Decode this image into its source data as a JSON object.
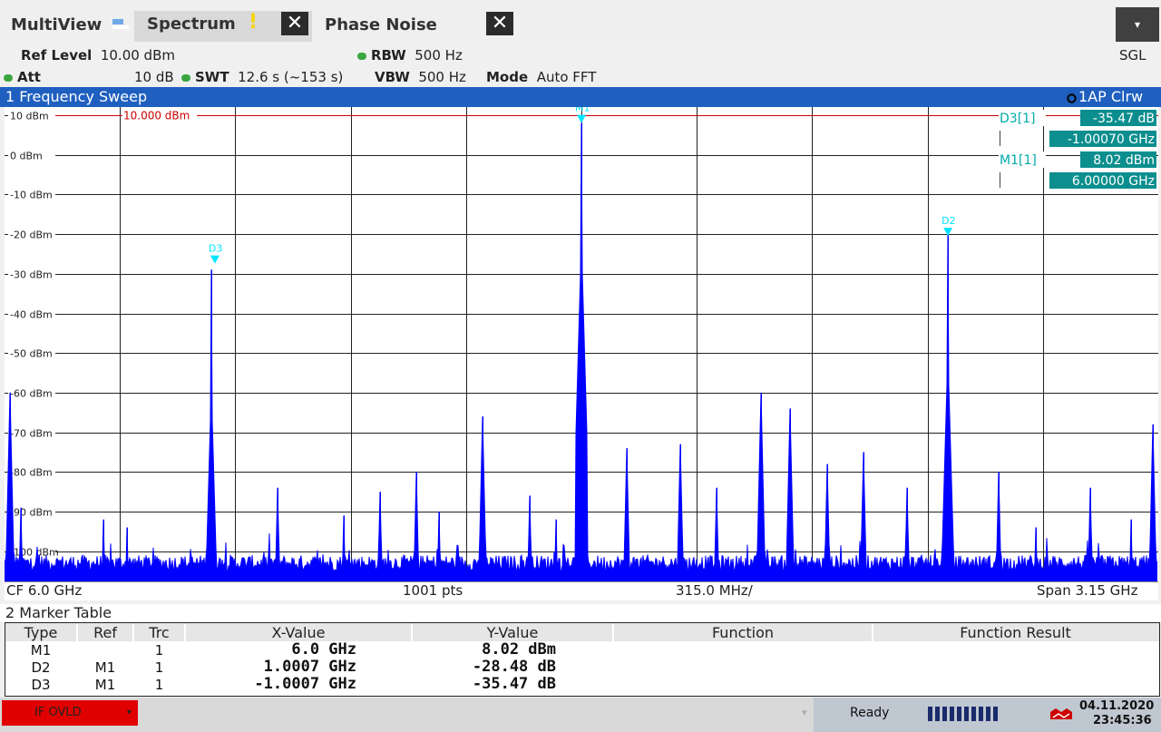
{
  "tabs": {
    "multiview": "MultiView",
    "spectrum": "Spectrum",
    "phase_noise": "Phase Noise",
    "close": "✕",
    "warning": "!",
    "menu": "▾"
  },
  "settings": {
    "ref_level_label": "Ref Level",
    "ref_level_value": "10.00 dBm",
    "att_label": "Att",
    "att_value": "10 dB",
    "swt_label": "SWT",
    "swt_value": "12.6 s (~153 s)",
    "rbw_label": "RBW",
    "rbw_value": "500 Hz",
    "vbw_label": "VBW",
    "vbw_value": "500 Hz",
    "mode_label": "Mode",
    "mode_value": "Auto FFT",
    "sgl": "SGL"
  },
  "diagram": {
    "title": "1 Frequency Sweep",
    "trace_info": "1AP Clrw",
    "ref_line_label": "10.000 dBm",
    "y_ticks": [
      "10 dBm",
      "0 dBm",
      "-10 dBm",
      "-20 dBm",
      "-30 dBm",
      "-40 dBm",
      "-50 dBm",
      "-60 dBm",
      "-70 dBm",
      "-80 dBm",
      "-90 dBm",
      "-100 dBm"
    ],
    "footer": {
      "cf": "CF 6.0 GHz",
      "pts": "1001 pts",
      "div": "315.0 MHz/",
      "span": "Span 3.15 GHz"
    },
    "marker_info": [
      {
        "name": "D3[1]",
        "value": "-35.47 dB",
        "x": "-1.00070 GHz"
      },
      {
        "name": "M1[1]",
        "value": "8.02 dBm",
        "x": "6.00000 GHz"
      }
    ],
    "marker_labels": [
      "M1",
      "D2",
      "D3"
    ]
  },
  "chart_data": {
    "type": "line",
    "xlim": [
      4.425,
      7.575
    ],
    "ylim": [
      -110,
      10
    ],
    "x_unit": "GHz",
    "y_unit": "dBm",
    "noise_floor": -103,
    "reference_level": 10.0,
    "peaks": [
      {
        "x": 4.44,
        "y": -60
      },
      {
        "x": 4.47,
        "y": -89
      },
      {
        "x": 4.52,
        "y": -101
      },
      {
        "x": 4.695,
        "y": -92
      },
      {
        "x": 4.76,
        "y": -94
      },
      {
        "x": 4.99,
        "y": -29
      },
      {
        "x": 5.17,
        "y": -84
      },
      {
        "x": 5.35,
        "y": -91
      },
      {
        "x": 5.45,
        "y": -85
      },
      {
        "x": 5.55,
        "y": -80
      },
      {
        "x": 5.61,
        "y": -90
      },
      {
        "x": 5.73,
        "y": -66
      },
      {
        "x": 5.86,
        "y": -86
      },
      {
        "x": 5.93,
        "y": -92
      },
      {
        "x": 6.0,
        "y": 8.02
      },
      {
        "x": 6.125,
        "y": -74
      },
      {
        "x": 6.27,
        "y": -73
      },
      {
        "x": 6.37,
        "y": -84
      },
      {
        "x": 6.49,
        "y": -60
      },
      {
        "x": 6.57,
        "y": -64
      },
      {
        "x": 6.67,
        "y": -78
      },
      {
        "x": 6.77,
        "y": -75
      },
      {
        "x": 6.89,
        "y": -84
      },
      {
        "x": 7.0,
        "y": -20
      },
      {
        "x": 7.14,
        "y": -80
      },
      {
        "x": 7.24,
        "y": -94
      },
      {
        "x": 7.39,
        "y": -84
      },
      {
        "x": 7.5,
        "y": -92
      },
      {
        "x": 7.56,
        "y": -68
      }
    ],
    "markers": [
      {
        "name": "M1",
        "x": 6.0,
        "y": 8.02
      },
      {
        "name": "D2",
        "x": 7.0007,
        "y": -20.46
      },
      {
        "name": "D3",
        "x": 4.9993,
        "y": -27.45
      }
    ]
  },
  "marker_table": {
    "title": "2 Marker Table",
    "headers": [
      "Type",
      "Ref",
      "Trc",
      "X-Value",
      "Y-Value",
      "Function",
      "Function Result"
    ],
    "rows": [
      {
        "type": "M1",
        "ref": "",
        "trc": "1",
        "x": "6.0 GHz",
        "y": "8.02 dBm"
      },
      {
        "type": "D2",
        "ref": "M1",
        "trc": "1",
        "x": "1.0007 GHz",
        "y": "-28.48 dB"
      },
      {
        "type": "D3",
        "ref": "M1",
        "trc": "1",
        "x": "-1.0007 GHz",
        "y": "-35.47 dB"
      }
    ]
  },
  "status": {
    "ifovld": "IF OVLD",
    "ready": "Ready",
    "date": "04.11.2020",
    "time": "23:45:36"
  },
  "colors": {
    "trace": "#0000ff",
    "marker": "#00e5ff",
    "ref_line": "#cc0000",
    "title_bar": "#1e5fbf"
  }
}
